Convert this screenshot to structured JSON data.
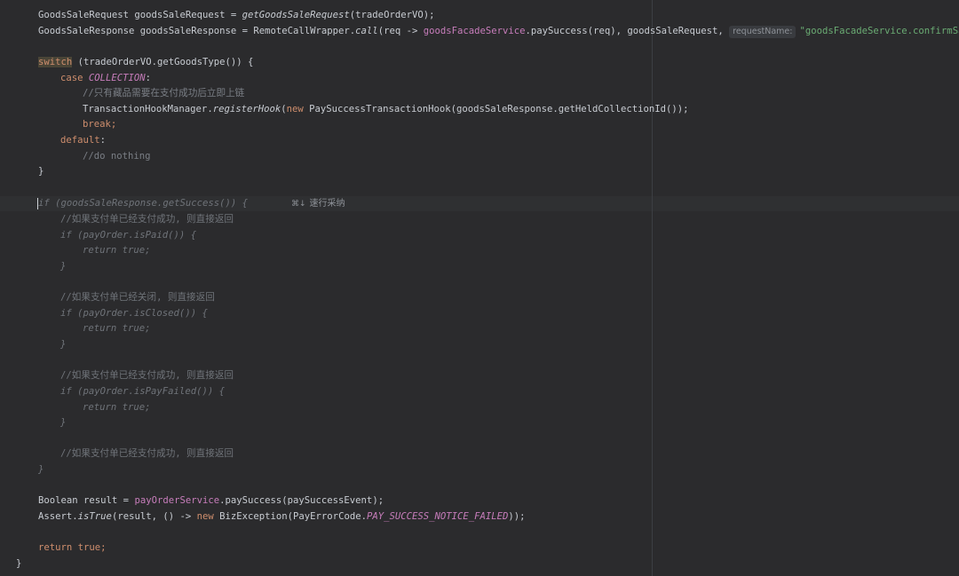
{
  "editor": {
    "lines": {
      "l1": {
        "a": "GoodsSaleRequest goodsSaleRequest = ",
        "b": "getGoodsSaleRequest",
        "c": "(tradeOrderVO);"
      },
      "l2": {
        "a": "GoodsSaleResponse goodsSaleResponse = RemoteCallWrapper.",
        "b": "call",
        "c": "(req -> ",
        "d": "goodsFacadeService",
        "e": ".paySuccess(req), goodsSaleRequest, ",
        "hint": "requestName:",
        "f": "\"goodsFacadeService.confirmSale\"",
        "g": ");"
      },
      "l3": {
        "a": "switch",
        "b": " (tradeOrderVO.getGoodsType()) {"
      },
      "l4": {
        "a": "case ",
        "b": "COLLECTION",
        "c": ":"
      },
      "l5": {
        "a": "//只有藏品需要在支付成功后立即上链"
      },
      "l6": {
        "a": "TransactionHookManager.",
        "b": "registerHook",
        "c": "(",
        "d": "new",
        "e": " PaySuccessTransactionHook(goodsSaleResponse.getHeldCollectionId());"
      },
      "l7": {
        "a": "break;"
      },
      "l8": {
        "a": "default",
        "b": ":"
      },
      "l9": {
        "a": "//do nothing"
      },
      "l10": {
        "a": "}"
      },
      "l11": {
        "a": "if (goodsSaleResponse.getSuccess()) {"
      },
      "l12": {
        "a": "//如果支付单已经支付成功, 则直接返回"
      },
      "l13": {
        "a": "if (payOrder.isPaid()) {"
      },
      "l14": {
        "a": "return true;"
      },
      "l15": {
        "a": "}"
      },
      "l16": {
        "a": "//如果支付单已经关闭, 则直接返回"
      },
      "l17": {
        "a": "if (payOrder.isClosed()) {"
      },
      "l18": {
        "a": "return true;"
      },
      "l19": {
        "a": "}"
      },
      "l20": {
        "a": "//如果支付单已经支付成功, 则直接返回"
      },
      "l21": {
        "a": "if (payOrder.isPayFailed()) {"
      },
      "l22": {
        "a": "return true;"
      },
      "l23": {
        "a": "}"
      },
      "l24": {
        "a": "//如果支付单已经支付成功, 则直接返回"
      },
      "l25": {
        "a": "}"
      },
      "l26": {
        "a": "Boolean result = ",
        "b": "payOrderService",
        "c": ".paySuccess(paySuccessEvent);"
      },
      "l27": {
        "a": "Assert.",
        "b": "isTrue",
        "c": "(result, () -> ",
        "d": "new",
        "e": " BizException(PayErrorCode.",
        "f": "PAY_SUCCESS_NOTICE_FAILED",
        "g": "));"
      },
      "l28": {
        "a": "return true",
        "b": ";"
      },
      "l29": {
        "a": "}"
      }
    },
    "inlay": {
      "icon": "⌘↓",
      "text": "速行采纳"
    }
  }
}
